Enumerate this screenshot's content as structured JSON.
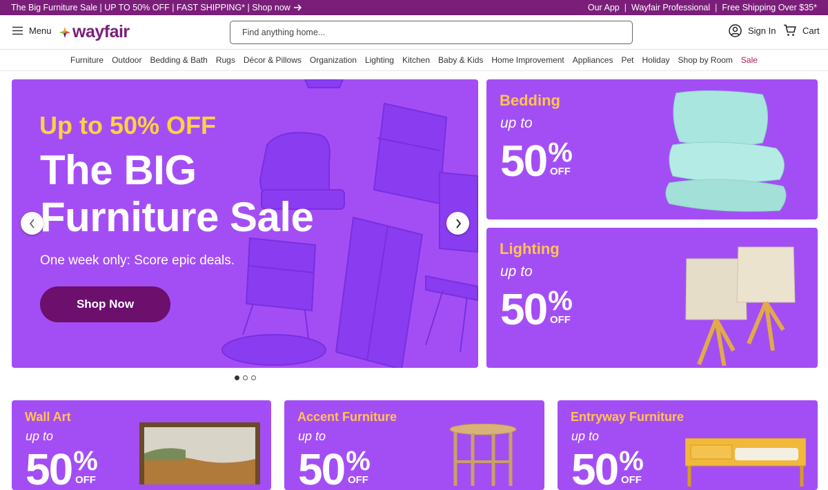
{
  "promo_bar": {
    "left_text": "The Big Furniture Sale | UP TO 50% OFF | FAST SHIPPING* | Shop now",
    "links": [
      "Our App",
      "Wayfair Professional",
      "Free Shipping Over $35*"
    ],
    "separator": "|"
  },
  "header": {
    "menu_label": "Menu",
    "logo_text": "wayfair",
    "search_placeholder": "Find anything home...",
    "signin_label": "Sign In",
    "cart_label": "Cart"
  },
  "nav": {
    "items": [
      "Furniture",
      "Outdoor",
      "Bedding & Bath",
      "Rugs",
      "Décor & Pillows",
      "Organization",
      "Lighting",
      "Kitchen",
      "Baby & Kids",
      "Home Improvement",
      "Appliances",
      "Pet",
      "Holiday",
      "Shop by Room",
      "Sale"
    ]
  },
  "hero": {
    "kicker": "Up to 50% OFF",
    "title_line1": "The BIG",
    "title_line2": "Furniture Sale",
    "subtitle": "One week only: Score epic deals.",
    "button_label": "Shop Now",
    "slide_count": 3,
    "active_slide": 1
  },
  "tiles": {
    "bedding": {
      "category": "Bedding",
      "upto": "up to",
      "number": "50",
      "percent": "%",
      "off": "OFF"
    },
    "lighting": {
      "category": "Lighting",
      "upto": "up to",
      "number": "50",
      "percent": "%",
      "off": "OFF"
    },
    "wall_art": {
      "category": "Wall Art",
      "upto": "up to",
      "number": "50",
      "percent": "%",
      "off": "OFF"
    },
    "accent": {
      "category": "Accent Furniture",
      "upto": "up to",
      "number": "50",
      "percent": "%",
      "off": "OFF"
    },
    "entryway": {
      "category": "Entryway Furniture",
      "upto": "up to",
      "number": "50",
      "percent": "%",
      "off": "OFF"
    }
  },
  "colors": {
    "brand_purple": "#7b1e7a",
    "tile_purple": "#a34ef5",
    "accent_yellow": "#ffd23f",
    "sale_red": "#b0184e",
    "button_dark": "#6c0f6d"
  },
  "icons": [
    "arrow-right-icon",
    "hamburger-icon",
    "wayfair-logo-icon",
    "user-icon",
    "cart-icon",
    "chevron-left-icon",
    "chevron-right-icon"
  ]
}
